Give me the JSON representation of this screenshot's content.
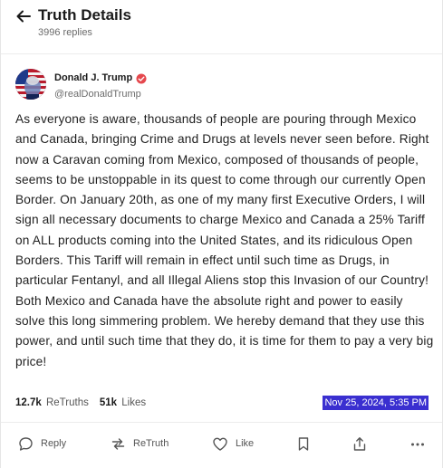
{
  "header": {
    "title": "Truth Details",
    "replies": "3996 replies"
  },
  "post": {
    "display_name": "Donald J. Trump",
    "handle": "@realDonaldTrump",
    "verified": true,
    "text": "As everyone is aware, thousands of people are pouring through Mexico and Canada, bringing Crime and Drugs at levels never seen before. Right now a Caravan coming from Mexico, composed of thousands of people, seems to be unstoppable in its quest to come through our currently Open Border. On January 20th, as one of my many first Executive Orders, I will sign all necessary documents to charge Mexico and Canada a 25% Tariff on ALL products coming into the United States, and its ridiculous Open Borders. This Tariff will remain in effect until such time as Drugs, in particular Fentanyl, and all Illegal Aliens stop this Invasion of our Country! Both Mexico and Canada have the absolute right and power to easily solve this long simmering problem. We hereby demand that they use this power, and until such time that they do, it is time for them to pay a very big price!",
    "retruths_count": "12.7k",
    "retruths_label": "ReTruths",
    "likes_count": "51k",
    "likes_label": "Likes",
    "timestamp": "Nov 25, 2024, 5:35 PM"
  },
  "actions": {
    "reply": "Reply",
    "retruth": "ReTruth",
    "like": "Like"
  },
  "icons": [
    "back-arrow-icon",
    "verified-icon",
    "reply-icon",
    "retruth-icon",
    "like-icon",
    "bookmark-icon",
    "share-icon",
    "more-icon"
  ],
  "colors": {
    "verified": "#e5484d",
    "timestamp_bg": "#3a2fd0"
  }
}
